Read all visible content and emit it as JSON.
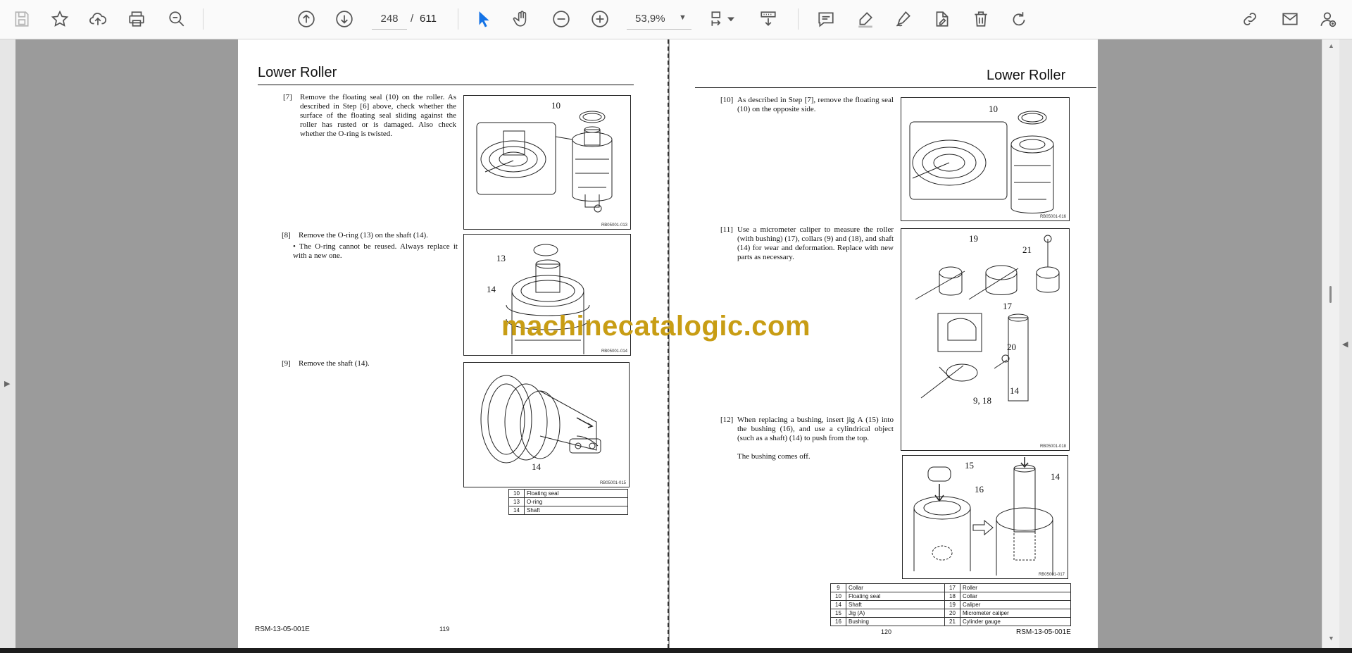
{
  "toolbar": {
    "page_current": "248",
    "page_separator": "/",
    "page_total": "611",
    "zoom": "53,9%",
    "icons": [
      "save-icon",
      "bookmark-star-icon",
      "cloud-upload-icon",
      "print-icon",
      "zoom-search-icon",
      "page-up-icon",
      "page-down-icon",
      "select-cursor-icon",
      "hand-tool-icon",
      "zoom-out-icon",
      "zoom-in-icon",
      "page-fit-icon",
      "scroll-mode-icon",
      "comment-icon",
      "highlight-pen-icon",
      "sign-icon",
      "edit-doc-icon",
      "delete-icon",
      "rotate-icon",
      "share-link-icon",
      "email-icon",
      "account-icon"
    ]
  },
  "left_page": {
    "header": "Lower Roller",
    "steps": [
      {
        "num": "[7]",
        "text": "Remove the floating seal (10) on the roller. As described in Step [6] above, check whether the surface of the floating seal sliding against the roller has rusted or is damaged. Also check whether the O-ring is twisted."
      },
      {
        "num": "[8]",
        "text": "Remove the O-ring (13) on the shaft (14).",
        "note": "• The O-ring cannot be reused. Always replace it with a new one."
      },
      {
        "num": "[9]",
        "text": "Remove the shaft (14)."
      }
    ],
    "figures": [
      {
        "code": "RB05001-013",
        "callouts": [
          "10"
        ]
      },
      {
        "code": "RB05001-014",
        "callouts": [
          "13",
          "14"
        ]
      },
      {
        "code": "RB05001-015",
        "callouts": [
          "14"
        ]
      }
    ],
    "legend": [
      {
        "n": "10",
        "label": "Floating seal"
      },
      {
        "n": "13",
        "label": "O-ring"
      },
      {
        "n": "14",
        "label": "Shaft"
      }
    ],
    "footer_doc": "RSM-13-05-001E",
    "footer_page": "119"
  },
  "right_page": {
    "header": "Lower Roller",
    "steps": [
      {
        "num": "[10]",
        "text": "As described in Step [7], remove the floating seal (10) on the opposite side."
      },
      {
        "num": "[11]",
        "text": "Use a micrometer caliper to measure the roller (with bushing) (17), collars (9) and (18), and shaft (14) for wear and deformation. Replace with new parts as necessary."
      },
      {
        "num": "[12]",
        "text": "When replacing a bushing, insert jig A (15) into the bushing (16), and use a cylindrical object (such as a shaft) (14) to push from the top.",
        "note": "The bushing comes off."
      }
    ],
    "figures": [
      {
        "code": "RB05001-016",
        "callouts": [
          "10"
        ]
      },
      {
        "code": "RB05001-018",
        "callouts": [
          "19",
          "21",
          "17",
          "20",
          "14",
          "9, 18"
        ]
      },
      {
        "code": "RB05001-017",
        "callouts": [
          "15",
          "16",
          "14"
        ]
      }
    ],
    "legend": [
      {
        "n": "9",
        "label": "Collar",
        "n2": "17",
        "label2": "Roller"
      },
      {
        "n": "10",
        "label": "Floating seal",
        "n2": "18",
        "label2": "Collar"
      },
      {
        "n": "14",
        "label": "Shaft",
        "n2": "19",
        "label2": "Caliper"
      },
      {
        "n": "15",
        "label": "Jig (A)",
        "n2": "20",
        "label2": "Micrometer caliper"
      },
      {
        "n": "16",
        "label": "Bushing",
        "n2": "21",
        "label2": "Cylinder gauge"
      }
    ],
    "footer_page": "120",
    "footer_doc": "RSM-13-05-001E"
  },
  "watermark": "machinecatalogic.com",
  "colors": {
    "watermark": "#c89d14",
    "select_active": "#1473e6",
    "page_bg": "#9b9b9b"
  }
}
